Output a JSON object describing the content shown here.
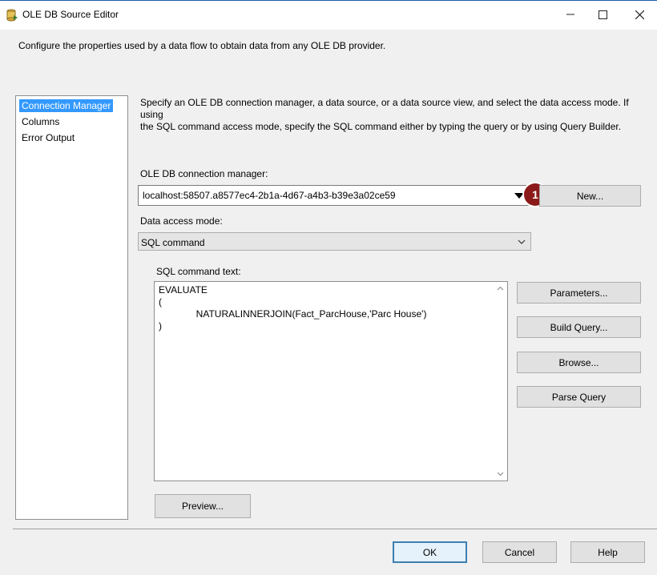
{
  "window": {
    "title": "OLE DB Source Editor",
    "icon": "ssis-source-icon"
  },
  "description": "Configure the properties used by a data flow to obtain data from any OLE DB provider.",
  "nav": {
    "items": [
      {
        "label": "Connection Manager",
        "selected": true
      },
      {
        "label": "Columns",
        "selected": false
      },
      {
        "label": "Error Output",
        "selected": false
      }
    ]
  },
  "main": {
    "instructions_line1": "Specify an OLE DB connection manager, a data source, or a data source view, and select the data access mode. If using",
    "instructions_line2": "the SQL command access mode, specify the SQL command either by typing the query or by using Query Builder.",
    "connection_label": "OLE DB connection manager:",
    "connection_value": "localhost:58507.a8577ec4-2b1a-4d67-a4b3-b39e3a02ce59",
    "new_button": "New...",
    "annotation_badge": "1",
    "access_mode_label": "Data access mode:",
    "access_mode_value": "SQL command",
    "sql_label": "SQL command text:",
    "sql_lines": [
      "EVALUATE",
      "(",
      "              NATURALINNERJOIN(Fact_ParcHouse,'Parc House')",
      ")"
    ],
    "side_buttons": {
      "parameters": "Parameters...",
      "build_query": "Build Query...",
      "browse": "Browse...",
      "parse_query": "Parse Query"
    },
    "preview_button": "Preview..."
  },
  "footer": {
    "ok": "OK",
    "cancel": "Cancel",
    "help": "Help"
  },
  "colors": {
    "selection": "#3399ff",
    "badge": "#8b1a1a",
    "default_button_border": "#3c7fb1"
  }
}
